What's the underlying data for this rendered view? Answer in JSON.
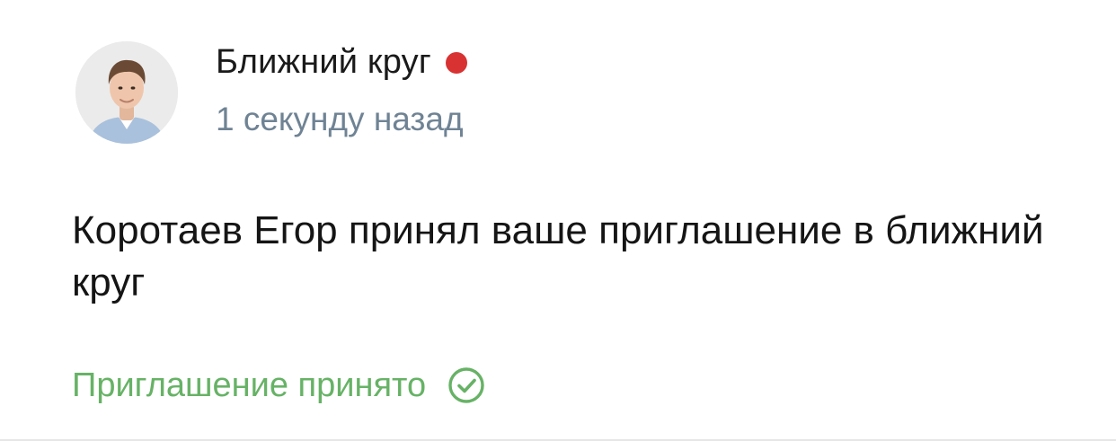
{
  "notification": {
    "title": "Ближний круг",
    "time": "1 секунду назад",
    "message": "Коротаев Егор принял ваше приглашение в ближний круг",
    "status": "Приглашение принято",
    "avatar_icon": "user-avatar-photo",
    "status_icon": "check-circle-icon",
    "colors": {
      "unread_dot": "#d83232",
      "status": "#67b266",
      "time": "#6f8394",
      "title": "#1a1a1a"
    }
  }
}
